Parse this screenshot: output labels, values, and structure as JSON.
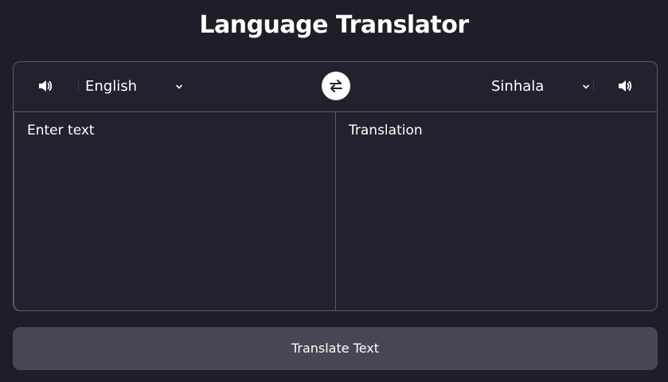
{
  "app": {
    "title": "Language Translator"
  },
  "controls": {
    "from_speaker_icon": "speaker-icon",
    "from_language": "English",
    "swap_icon": "swap-arrows-icon",
    "to_language": "Sinhala",
    "to_speaker_icon": "speaker-icon"
  },
  "input": {
    "placeholder": "Enter text",
    "value": ""
  },
  "output": {
    "placeholder": "Translation",
    "value": ""
  },
  "actions": {
    "translate_label": "Translate Text"
  },
  "colors": {
    "background": "#1e1e28",
    "panel": "#22222e",
    "border": "#5a5a6a",
    "button": "#464654",
    "text": "#ffffff"
  }
}
